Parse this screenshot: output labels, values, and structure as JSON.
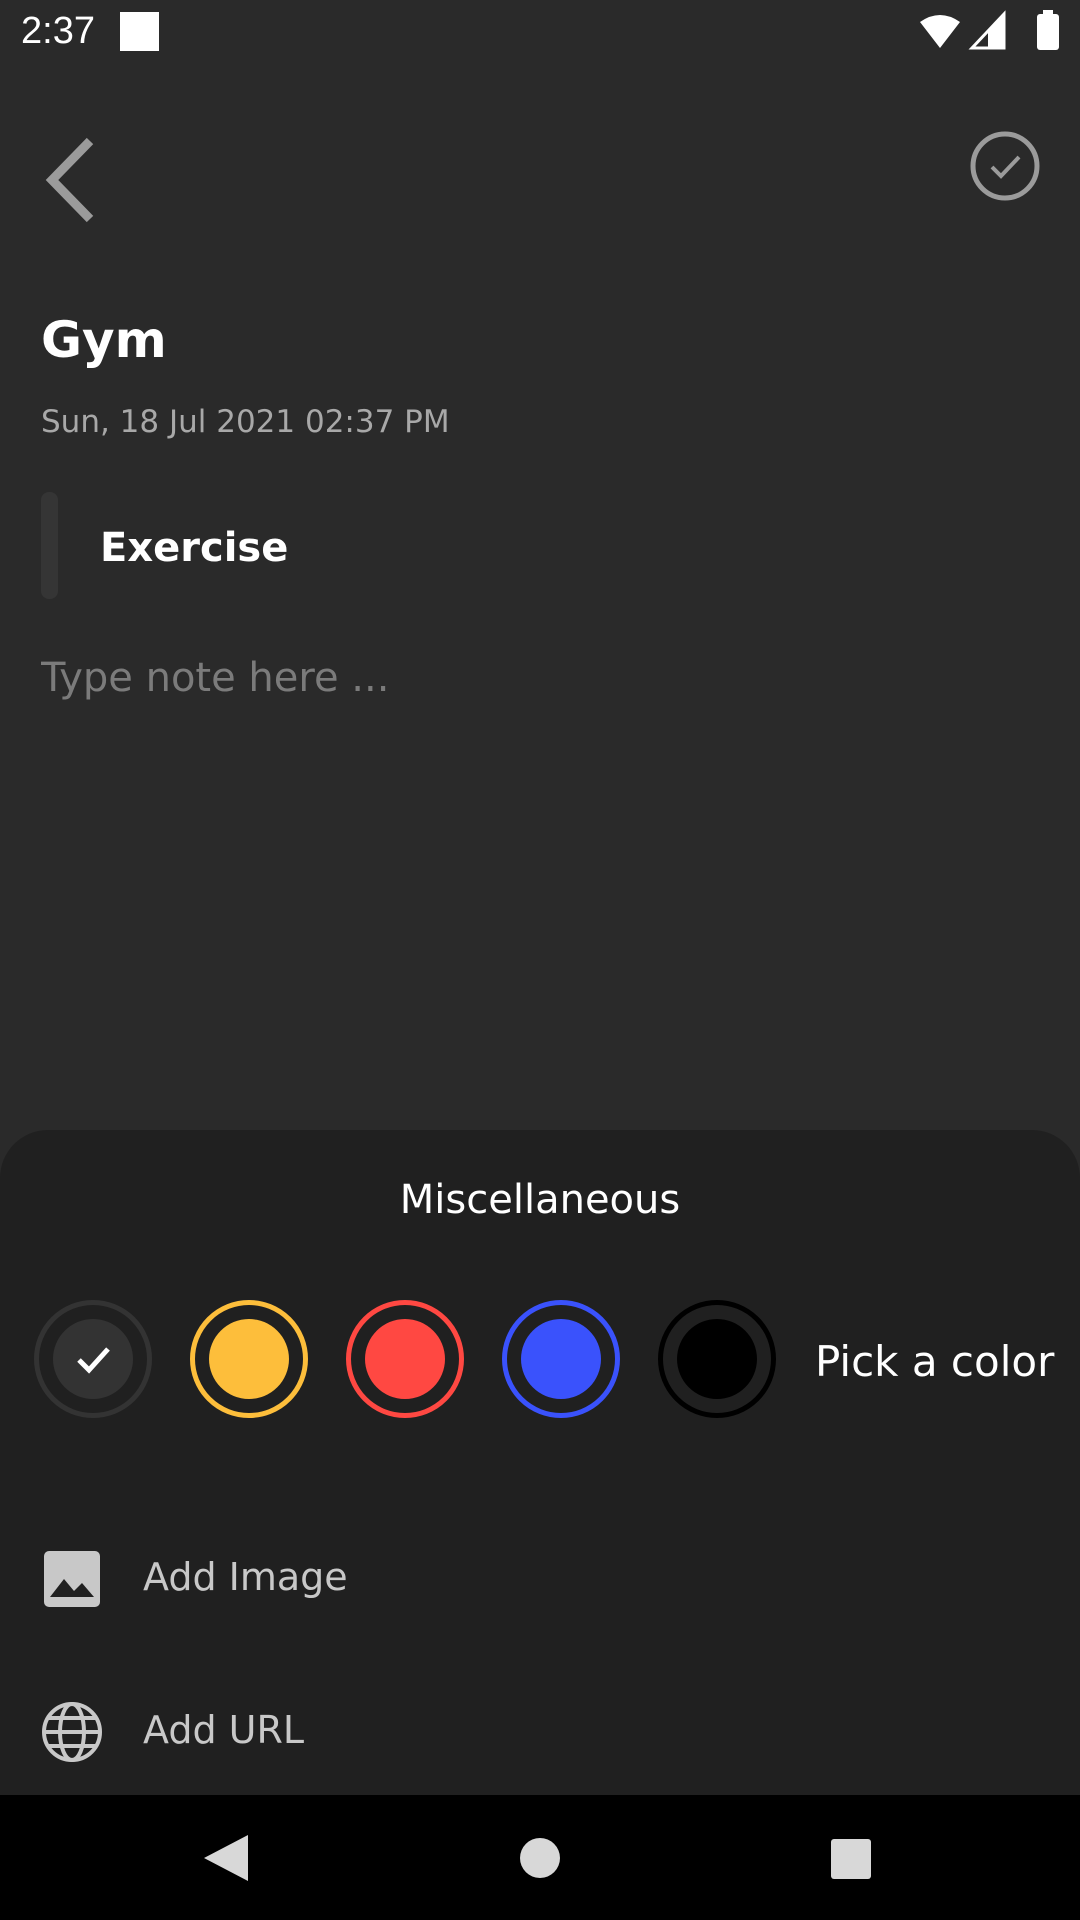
{
  "status_bar": {
    "time": "2:37",
    "icons": [
      "notification-square-icon",
      "wifi-icon",
      "cell-signal-icon",
      "battery-icon"
    ]
  },
  "app_bar": {
    "back_icon": "chevron-left-icon",
    "done_icon": "check-circle-icon"
  },
  "note": {
    "title": "Gym",
    "datetime": "Sun, 18 Jul 2021 02:37 PM",
    "subtitle": "Exercise",
    "body_placeholder": "Type note here ..."
  },
  "misc_sheet": {
    "title": "Miscellaneous",
    "colors": [
      {
        "name": "default",
        "hex": "#333333",
        "selected": true
      },
      {
        "name": "yellow",
        "hex": "#FDBE3B",
        "selected": false
      },
      {
        "name": "red",
        "hex": "#FF4842",
        "selected": false
      },
      {
        "name": "blue",
        "hex": "#3A52FC",
        "selected": false
      },
      {
        "name": "black",
        "hex": "#000000",
        "selected": false
      }
    ],
    "pick_color_label": "Pick a color",
    "options": [
      {
        "icon": "image-icon",
        "label": "Add Image"
      },
      {
        "icon": "globe-icon",
        "label": "Add URL"
      }
    ]
  },
  "nav_bar": {
    "buttons": [
      "back-triangle-icon",
      "home-circle-icon",
      "recents-square-icon"
    ]
  },
  "theme": {
    "background": "#2a2a2a",
    "sheet_background": "#202020",
    "secondary_text": "#a8a8a8",
    "placeholder_text": "#7b7b7b"
  }
}
